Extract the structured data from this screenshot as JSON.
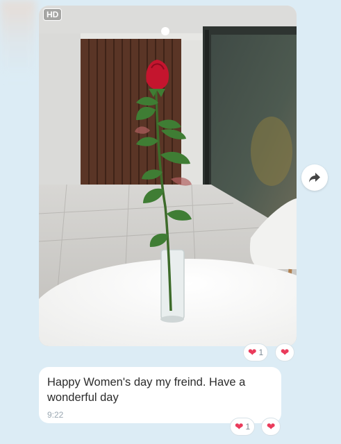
{
  "photo": {
    "badge": "HD",
    "subject": "rose-in-vase-photo"
  },
  "icons": {
    "forward": "forward-arrow-icon",
    "heart": "heart-icon"
  },
  "colors": {
    "background": "#dcecf5",
    "bubble": "#ffffff",
    "heart": "#ea3b5b",
    "time": "#9aa7b1"
  },
  "photo_reactions": {
    "count": "1"
  },
  "message": {
    "text": "Happy Women's day my freind. Have a wonderful day",
    "time": "9:22",
    "reactions": {
      "count": "1"
    }
  }
}
